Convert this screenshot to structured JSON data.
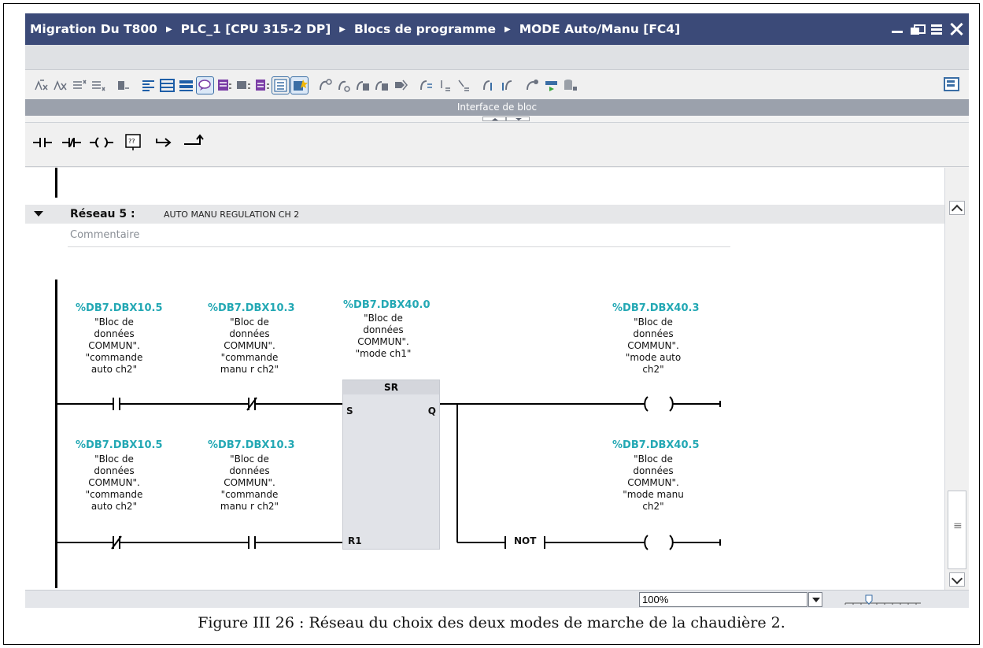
{
  "window": {
    "breadcrumbs": [
      "Migration Du T800",
      "PLC_1 [CPU 315-2 DP]",
      "Blocs de programme",
      "MODE Auto/Manu [FC4]"
    ]
  },
  "interface_bar": {
    "label": "Interface de bloc"
  },
  "network": {
    "title": "Réseau 5 :",
    "description": "AUTO MANU REGULATION CH 2",
    "comment_placeholder": "Commentaire",
    "contacts": [
      {
        "address": "%DB7.DBX10.5",
        "symbol": [
          "\"Bloc de",
          "données",
          "COMMUN\".",
          "\"commande",
          "auto ch2\""
        ],
        "type": "normally-open"
      },
      {
        "address": "%DB7.DBX10.3",
        "symbol": [
          "\"Bloc de",
          "données",
          "COMMUN\".",
          "\"commande",
          "manu r ch2\""
        ],
        "type": "normally-closed"
      },
      {
        "address": "%DB7.DBX10.5",
        "symbol": [
          "\"Bloc de",
          "données",
          "COMMUN\".",
          "\"commande",
          "auto ch2\""
        ],
        "type": "normally-closed"
      },
      {
        "address": "%DB7.DBX10.3",
        "symbol": [
          "\"Bloc de",
          "données",
          "COMMUN\".",
          "\"commande",
          "manu r ch2\""
        ],
        "type": "normally-open"
      }
    ],
    "sr_block": {
      "address": "%DB7.DBX40.0",
      "symbol": [
        "\"Bloc de",
        "données",
        "COMMUN\".",
        "\"mode ch1\""
      ],
      "title": "SR",
      "pin_s": "S",
      "pin_q": "Q",
      "pin_r1": "R1"
    },
    "coils": [
      {
        "address": "%DB7.DBX40.3",
        "symbol": [
          "\"Bloc de",
          "données",
          "COMMUN\".",
          "\"mode auto",
          "ch2\""
        ]
      },
      {
        "address": "%DB7.DBX40.5",
        "symbol": [
          "\"Bloc de",
          "données",
          "COMMUN\".",
          "\"mode manu",
          "ch2\""
        ]
      }
    ],
    "not_label": "NOT"
  },
  "status": {
    "zoom": "100%"
  },
  "caption": "Figure III 26 : Réseau du choix des deux modes de marche de la chaudière 2.",
  "colors": {
    "titlebar": "#3b4a78",
    "address": "#23a8b4",
    "sr_block": "#e1e3e8",
    "interface_bar": "#9ba1ac"
  }
}
